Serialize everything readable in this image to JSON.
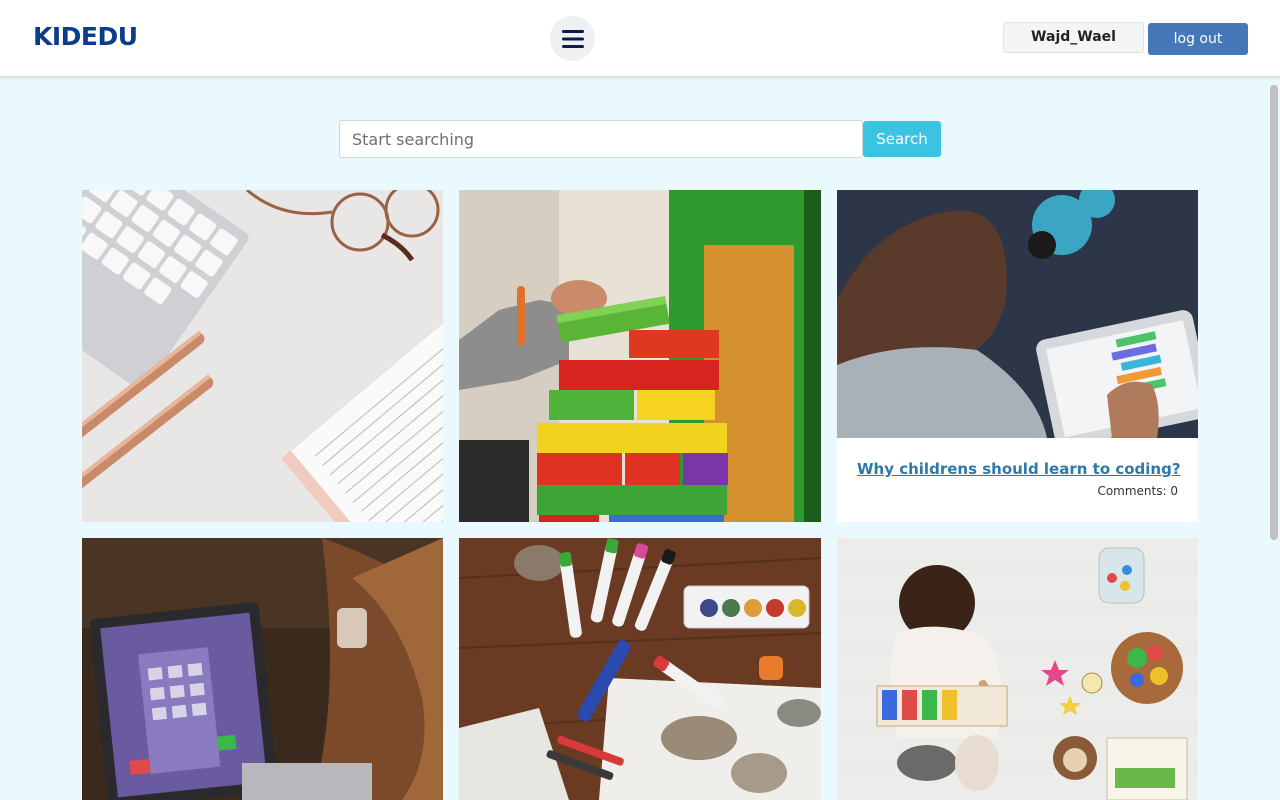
{
  "header": {
    "logo": "KIDEDU",
    "menu_icon": "hamburger-menu-icon",
    "username": "Wajd_Wael",
    "logout_label": "log out"
  },
  "search": {
    "placeholder": "Start searching",
    "value": "",
    "button_label": "Search"
  },
  "cards": [
    {
      "image": "desk-keyboard-glasses-notebook-photo",
      "title": "",
      "comments": ""
    },
    {
      "image": "child-stacking-wooden-blocks-photo",
      "title": "",
      "comments": ""
    },
    {
      "image": "child-coding-on-tablet-photo",
      "title": "Why childrens should learn to coding?",
      "comments": "Comments: 0"
    },
    {
      "image": "child-using-laptop-photo",
      "title": "",
      "comments": ""
    },
    {
      "image": "markers-paints-rocks-table-photo",
      "title": "",
      "comments": ""
    },
    {
      "image": "toddler-playing-with-toys-photo",
      "title": "",
      "comments": ""
    }
  ],
  "colors": {
    "page_bg": "#e9f9fe",
    "logo": "#0c3c8c",
    "logout_button": "#4578b8",
    "search_button": "#3bc3e2",
    "link": "#2d7aa8"
  }
}
